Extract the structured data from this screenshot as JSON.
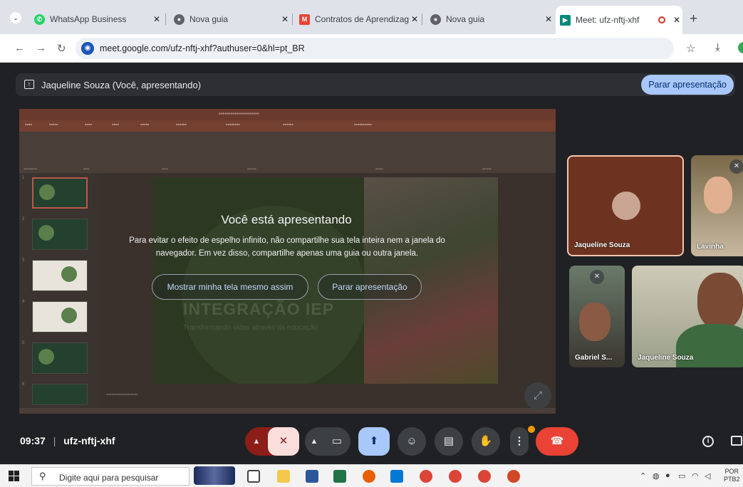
{
  "browser": {
    "tabs": [
      {
        "label": "WhatsApp Business",
        "close": "✕",
        "icon": "whatsapp-icon",
        "color": "#25d366"
      },
      {
        "label": "Nova guia",
        "close": "✕",
        "icon": "chrome-icon",
        "color": "#5f6368"
      },
      {
        "label": "Contratos de Aprendizagem",
        "close": "✕",
        "icon": "gmail-icon",
        "color": "#ea4335"
      },
      {
        "label": "Nova guia",
        "close": "✕",
        "icon": "chrome-icon",
        "color": "#5f6368"
      },
      {
        "label": "Meet: ufz-nftj-xhf",
        "close": "✕",
        "icon": "meet-icon",
        "color": "#00897b",
        "active": true
      }
    ],
    "new_tab": "+",
    "url": "meet.google.com/ufz-nftj-xhf?authuser=0&hl=pt_BR"
  },
  "meet": {
    "presenting_banner": "Jaqueline Souza (Você, apresentando)",
    "stop_presenting_top": "Parar apresentação",
    "overlay": {
      "title": "Você está apresentando",
      "body": "Para evitar o efeito de espelho infinito, não compartilhe sua tela inteira nem a janela do navegador. Em vez disso, compartilhe apenas uma guia ou outra janela.",
      "show_anyway": "Mostrar minha tela mesmo assim",
      "stop": "Parar apresentação"
    },
    "shared_slide": {
      "heading": "INTEGRAÇÃO IEP",
      "subheading": "Transformando vidas através da educação"
    },
    "participants": [
      {
        "name": "Jaqueline Souza"
      },
      {
        "name": "Lavinha"
      },
      {
        "name": "Gabriel S..."
      },
      {
        "name": "Jaqueline Souza"
      }
    ],
    "time": "09:37",
    "meeting_code": "ufz-nftj-xhf",
    "separator": "|"
  },
  "taskbar": {
    "search_placeholder": "Digite aqui para pesquisar",
    "lang_top": "POR",
    "lang_bottom": "PTB2"
  },
  "colors": {
    "accent_blue": "#a8c7fa",
    "end_call_red": "#ea4335",
    "self_tile_border": "#f6c6b0"
  }
}
